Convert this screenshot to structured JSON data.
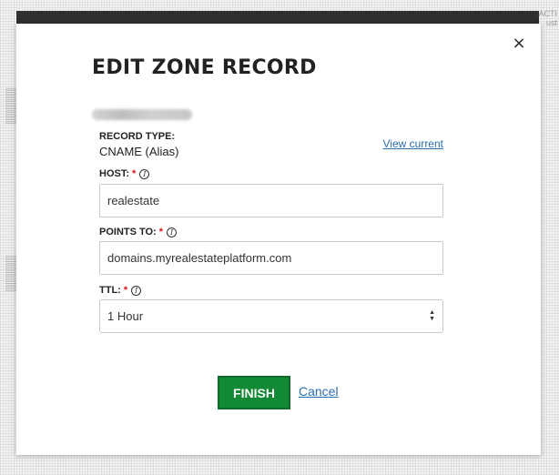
{
  "edge_text": [
    "ACTI",
    "ust"
  ],
  "dialog": {
    "title": "EDIT ZONE RECORD",
    "close_symbol": "×"
  },
  "record": {
    "type_label": "RECORD TYPE:",
    "type_value": "CNAME (Alias)",
    "view_current": "View current"
  },
  "fields": {
    "host": {
      "label": "HOST:",
      "required": "*",
      "value": "realestate"
    },
    "points_to": {
      "label": "POINTS TO:",
      "required": "*",
      "value": "domains.myrealestateplatform.com"
    },
    "ttl": {
      "label": "TTL:",
      "required": "*",
      "selected": "1 Hour"
    }
  },
  "info_glyph": "i",
  "actions": {
    "finish": "FINISH",
    "cancel": "Cancel"
  },
  "colors": {
    "finish_green": "#128a35",
    "link_blue": "#2a6db3",
    "required_red": "#d11111"
  }
}
